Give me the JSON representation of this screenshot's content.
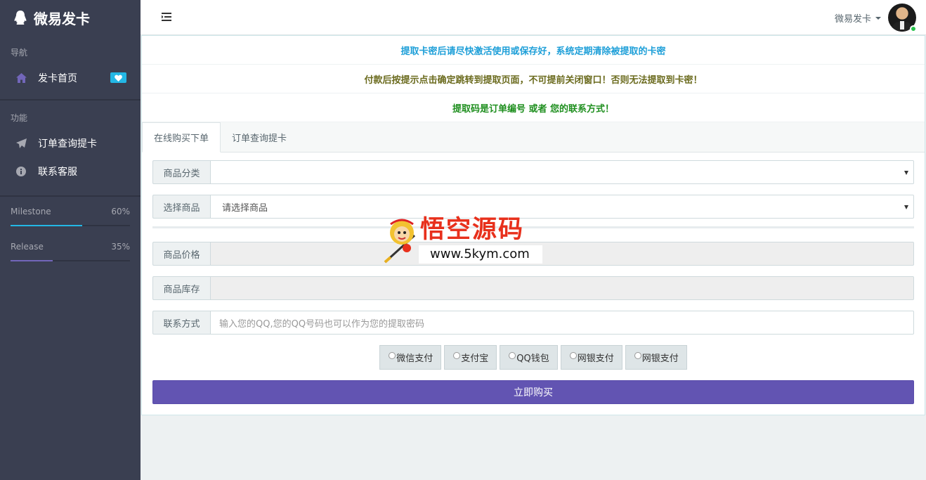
{
  "sidebar": {
    "brand": "微易发卡",
    "nav_header": "导航",
    "func_header": "功能",
    "items": [
      {
        "label": "发卡首页",
        "icon": "home-icon"
      },
      {
        "label": "订单查询提卡",
        "icon": "paper-plane-icon"
      },
      {
        "label": "联系客服",
        "icon": "info-circle-icon"
      }
    ],
    "progress": [
      {
        "name": "Milestone",
        "percent": "60%",
        "value": 0.6,
        "color": "#23b7e5"
      },
      {
        "name": "Release",
        "percent": "35%",
        "value": 0.35,
        "color": "#7266ba"
      }
    ]
  },
  "header": {
    "user_name": "微易发卡"
  },
  "notices": [
    {
      "text": "提取卡密后请尽快激活使用或保存好，系统定期清除被提取的卡密",
      "color": "#1e9fd8"
    },
    {
      "text": "付款后按提示点击确定跳转到提取页面，不可提前关闭窗口！否则无法提取到卡密！",
      "color": "#6b6b1e"
    },
    {
      "text": "提取码是订单编号 或者 您的联系方式！",
      "color": "#1f8f1f"
    }
  ],
  "tabs": [
    {
      "label": "在线购买下单"
    },
    {
      "label": "订单查询提卡"
    }
  ],
  "form": {
    "category_label": "商品分类",
    "category_value": "",
    "product_label": "选择商品",
    "product_value": "请选择商品",
    "price_label": "商品价格",
    "price_value": "",
    "stock_label": "商品库存",
    "stock_value": "",
    "contact_label": "联系方式",
    "contact_placeholder": "输入您的QQ,您的QQ号码也可以作为您的提取密码"
  },
  "payments": [
    {
      "label": "微信支付"
    },
    {
      "label": "支付宝"
    },
    {
      "label": "QQ钱包"
    },
    {
      "label": "网银支付"
    },
    {
      "label": "网银支付"
    }
  ],
  "buy_button": "立即购买",
  "watermark": {
    "title": "悟空源码",
    "url": "www.5kym.com"
  },
  "colors": {
    "accent": "#6254b2",
    "sidebar_bg": "#3a3f51",
    "badge": "#23b7e5"
  }
}
